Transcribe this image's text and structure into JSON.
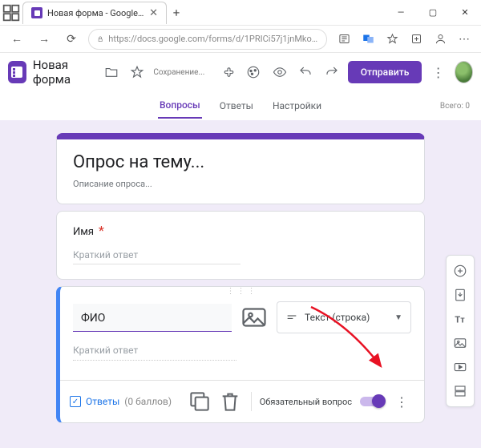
{
  "window": {
    "tab_title": "Новая форма - Google Формы",
    "url": "https://docs.google.com/forms/d/1PRICi57j1jnMkoPZxIQDK5SZBJEQRBTO..."
  },
  "header": {
    "form_name": "Новая форма",
    "saving_status": "Сохранение...",
    "send_button": "Отправить"
  },
  "tabs": {
    "questions": "Вопросы",
    "responses": "Ответы",
    "settings": "Настройки",
    "total_label": "Всего: 0"
  },
  "title_card": {
    "title": "Опрос на тему...",
    "description": "Описание опроса..."
  },
  "question1": {
    "label": "Имя",
    "placeholder": "Краткий ответ"
  },
  "question2": {
    "label": "ФИО",
    "type_label": "Текст (строка)",
    "short_answer_placeholder": "Краткий ответ",
    "answer_key_label": "Ответы",
    "points_label": "(0 баллов)",
    "required_label": "Обязательный вопрос"
  }
}
